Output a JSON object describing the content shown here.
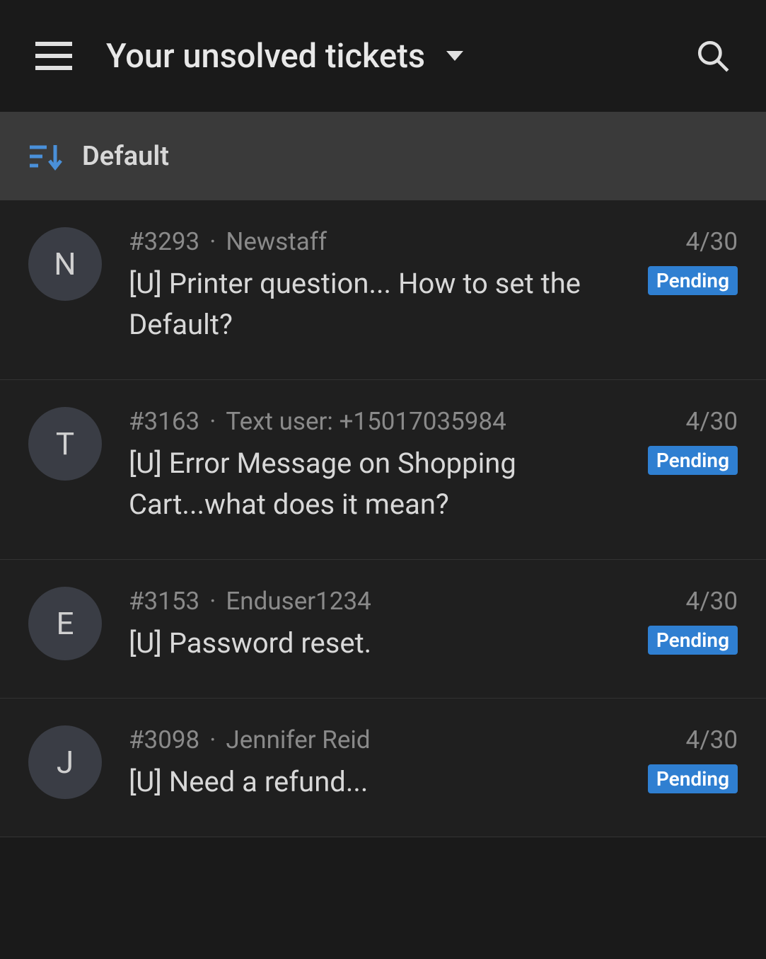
{
  "header": {
    "title": "Your unsolved tickets"
  },
  "sort": {
    "label": "Default"
  },
  "tickets": [
    {
      "avatar": "N",
      "id": "#3293",
      "requester": "Newstaff",
      "date": "4/30",
      "subject": "[U] Printer question... How to set the Default?",
      "status": "Pending"
    },
    {
      "avatar": "T",
      "id": "#3163",
      "requester": "Text user: +15017035984",
      "date": "4/30",
      "subject": "[U] Error Message on Shopping Cart...what does it mean?",
      "status": "Pending"
    },
    {
      "avatar": "E",
      "id": "#3153",
      "requester": "Enduser1234",
      "date": "4/30",
      "subject": "[U] Password reset.",
      "status": "Pending"
    },
    {
      "avatar": "J",
      "id": "#3098",
      "requester": "Jennifer Reid",
      "date": "4/30",
      "subject": "[U] Need a refund...",
      "status": "Pending"
    }
  ]
}
